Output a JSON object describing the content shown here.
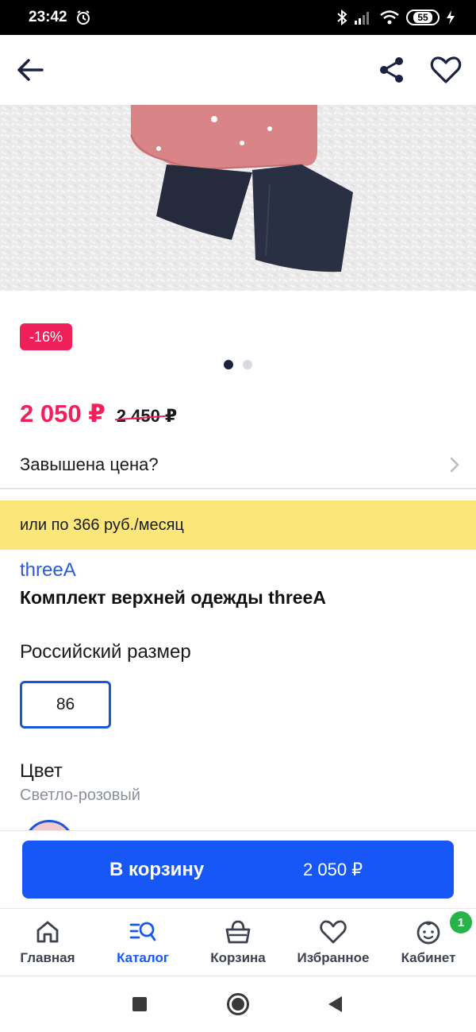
{
  "status_bar": {
    "time": "23:42",
    "battery": "55"
  },
  "product": {
    "discount_badge": "-16%",
    "price_current": "2 050 ₽",
    "price_old": "2 450 ₽",
    "overpriced_link": "Завышена цена?",
    "installment": "или по 366 руб./месяц",
    "brand": "threeA",
    "title": "Комплект верхней одежды threeA",
    "size_label": "Российский размер",
    "size_selected": "86",
    "color_label": "Цвет",
    "color_value": "Светло-розовый",
    "gallery": {
      "slides": 2,
      "active": 1
    }
  },
  "cart": {
    "button_label": "В корзину",
    "button_amount": "2 050 ₽"
  },
  "tabs": [
    {
      "label": "Главная",
      "icon": "home-icon"
    },
    {
      "label": "Каталог",
      "icon": "catalog-search-icon",
      "active": true
    },
    {
      "label": "Корзина",
      "icon": "basket-icon"
    },
    {
      "label": "Избранное",
      "icon": "heart-icon"
    },
    {
      "label": "Кабинет",
      "icon": "face-icon",
      "badge": "1"
    }
  ],
  "colors": {
    "accent": "#1757f5",
    "sale": "#f0205a",
    "installment_bg": "#fbe67a",
    "badge_green": "#25b34a"
  }
}
